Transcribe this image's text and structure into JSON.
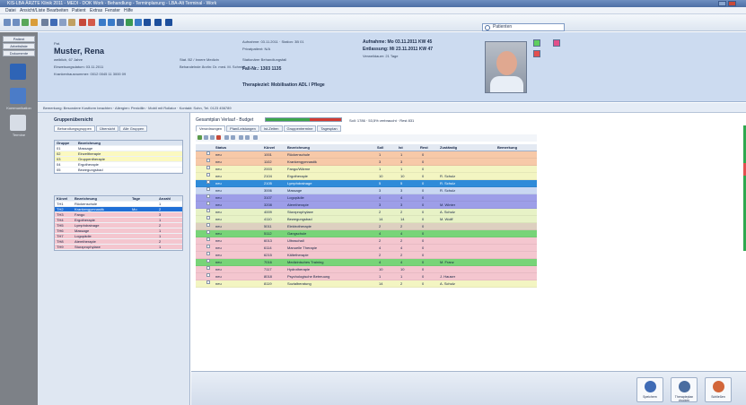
{
  "window": {
    "title": "KIS-LBA ÄRZTE Klinik 2011 - MEDI - DOK Work - Behandlung - Terminplanung - LBA-Alt Terminal - Work"
  },
  "menu": [
    "Datei",
    "Ansicht/Liste",
    "Bearbeiten",
    "Patient",
    "Extras",
    "Fenster",
    "Hilfe"
  ],
  "toolbar": {
    "search_placeholder": "Suchen",
    "search_value": "Patienten"
  },
  "leftbar": [
    {
      "label": "Patient"
    },
    {
      "label": "Arbeitsliste"
    },
    {
      "label": "Dokumente"
    },
    {
      "label": "Kommunikation"
    },
    {
      "label": "Termine"
    }
  ],
  "header": {
    "patient_small": "Pat.",
    "patient_name": "Muster, Rena",
    "lines": [
      "weiblich, 67 Jahre",
      "Einweisungsdatum: 03.11.2011",
      "Krankenhausnummer: 0012 0045 11 3000 09"
    ],
    "ward_lines": [
      "Stat. B2 / Innere Medizin",
      "Behandelnde Ärztin: Dr. med. M. Schmidt"
    ],
    "case_lines": [
      "Aufnahme: 03.11.2011 · Station: 3B 01",
      "Privatpatient: N/A",
      "Stationärer Behandlungsfall"
    ],
    "fall_label": "Fall-Nr.: 1303 1135",
    "diagnosis": "Therapieziel: Mobilisation ADL / Pflege",
    "dates": [
      "Aufnahme: Mo 03.11.2011 KW 45",
      "Entlassung: Mi 23.11.2011 KW 47",
      "Verweildauer: 21 Tage"
    ]
  },
  "infobar": "Bemerkung: Besondere Kostform beachten · Allergien: Penicillin · Mobil mit Rollator · Kontakt: Sohn, Tel. 0123 456789",
  "leftpane": {
    "title": "Gruppenübersicht",
    "tabs": [
      "Behandlungsgruppen",
      "Übersicht",
      "Alle Gruppen"
    ],
    "grid1_headers": [
      "Gruppe",
      "Bezeichnung"
    ],
    "grid1_rows": [
      {
        "code": "01",
        "name": "Massage",
        "bg": "#ffffff"
      },
      {
        "code": "02",
        "name": "Einzeltherapie",
        "bg": "#fbf9c0"
      },
      {
        "code": "03",
        "name": "Gruppentherapie",
        "bg": "#fbf9c0"
      },
      {
        "code": "04",
        "name": "Ergotherapie",
        "bg": "#ffffff"
      },
      {
        "code": "05",
        "name": "Bewegungsbad",
        "bg": "#ffffff"
      }
    ],
    "grid2_headers": [
      "Kürzel",
      "Bezeichnung",
      "Tage",
      "Anzahl"
    ],
    "grid2_rows": [
      {
        "code": "TH1",
        "name": "Rückenschule",
        "f": "",
        "n": "1",
        "bg": "#ffffff"
      },
      {
        "code": "TH2",
        "name": "Krankengymnastik",
        "f": "Mo",
        "n": "2",
        "bg": "#1f6fd6"
      },
      {
        "code": "TH3",
        "name": "Fango",
        "f": "",
        "n": "3",
        "bg": "#f4c6cf"
      },
      {
        "code": "TH4",
        "name": "Ergotherapie",
        "f": "",
        "n": "1",
        "bg": "#f4c6cf"
      },
      {
        "code": "TH5",
        "name": "Lymphdrainage",
        "f": "",
        "n": "2",
        "bg": "#f4c6cf"
      },
      {
        "code": "TH6",
        "name": "Massage",
        "f": "",
        "n": "1",
        "bg": "#f4c6cf"
      },
      {
        "code": "TH7",
        "name": "Logopädie",
        "f": "",
        "n": "1",
        "bg": "#f4c6cf"
      },
      {
        "code": "TH8",
        "name": "Atemtherapie",
        "f": "",
        "n": "2",
        "bg": "#f4c6cf"
      },
      {
        "code": "TH9",
        "name": "Sturzprophylaxe",
        "f": "",
        "n": "1",
        "bg": "#f4c6cf"
      }
    ]
  },
  "main": {
    "title": "Gesamtplan Verlauf - Budget",
    "progress": {
      "green": 0.58,
      "red": 0.42,
      "label": "Soll: 1786 · 53,5% verbraucht · Rest 831"
    },
    "tabs": [
      "Verordnungen",
      "Plan/Leistungen",
      "Ist-Zeiten",
      "Gruppentermine",
      "Tagesplan"
    ],
    "columns": [
      "Status",
      "Kürzel",
      "Bezeichnung",
      "Soll",
      "Ist",
      "Rest",
      "Zuständig",
      "Bemerkung"
    ],
    "rows": [
      {
        "status": "neu",
        "code": "1001",
        "name": "Rückenschule",
        "a": "1",
        "b": "1",
        "c": "0",
        "who": "",
        "bg": "#f7c9a8"
      },
      {
        "status": "neu",
        "code": "1102",
        "name": "Krankengymnastik",
        "a": "3",
        "b": "3",
        "c": "0",
        "who": "",
        "bg": "#f7c9a8"
      },
      {
        "status": "neu",
        "code": "2003",
        "name": "Fango/Wärme",
        "a": "1",
        "b": "1",
        "c": "0",
        "who": "",
        "bg": "#f3f5c2"
      },
      {
        "status": "neu",
        "code": "2104",
        "name": "Ergotherapie",
        "a": "10",
        "b": "10",
        "c": "0",
        "who": "R. Schulz",
        "bg": "#f3f5c2"
      },
      {
        "status": "neu",
        "code": "2105",
        "name": "Lymphdrainage",
        "a": "5",
        "b": "5",
        "c": "0",
        "who": "R. Schulz",
        "bg": "#2f8bd9"
      },
      {
        "status": "neu",
        "code": "3006",
        "name": "Massage",
        "a": "3",
        "b": "3",
        "c": "0",
        "who": "R. Schulz",
        "bg": "#c9d7f2"
      },
      {
        "status": "neu",
        "code": "3107",
        "name": "Logopädie",
        "a": "4",
        "b": "4",
        "c": "0",
        "who": "",
        "bg": "#9d9ee8"
      },
      {
        "status": "neu",
        "code": "3208",
        "name": "Atemtherapie",
        "a": "3",
        "b": "3",
        "c": "0",
        "who": "M. Winter",
        "bg": "#9d9ee8"
      },
      {
        "status": "neu",
        "code": "4009",
        "name": "Sturzprophylaxe",
        "a": "2",
        "b": "2",
        "c": "0",
        "who": "A. Schulz",
        "bg": "#e7f2c6"
      },
      {
        "status": "neu",
        "code": "4110",
        "name": "Bewegungsbad",
        "a": "14",
        "b": "14",
        "c": "0",
        "who": "M. Wolff",
        "bg": "#e7f2c6"
      },
      {
        "status": "neu",
        "code": "5011",
        "name": "Elektrotherapie",
        "a": "2",
        "b": "2",
        "c": "0",
        "who": "",
        "bg": "#ddd0c0"
      },
      {
        "status": "neu",
        "code": "5112",
        "name": "Gangschule",
        "a": "4",
        "b": "4",
        "c": "0",
        "who": "",
        "bg": "#78d478"
      },
      {
        "status": "neu",
        "code": "6013",
        "name": "Ultraschall",
        "a": "2",
        "b": "2",
        "c": "0",
        "who": "",
        "bg": "#f4c6cf"
      },
      {
        "status": "neu",
        "code": "6114",
        "name": "Manuelle Therapie",
        "a": "4",
        "b": "4",
        "c": "0",
        "who": "",
        "bg": "#f4c6cf"
      },
      {
        "status": "neu",
        "code": "6215",
        "name": "Kältetherapie",
        "a": "2",
        "b": "2",
        "c": "0",
        "who": "",
        "bg": "#f4c6cf"
      },
      {
        "status": "neu",
        "code": "7016",
        "name": "Medizinisches Training",
        "a": "4",
        "b": "4",
        "c": "0",
        "who": "M. Franz",
        "bg": "#78d478"
      },
      {
        "status": "neu",
        "code": "7117",
        "name": "Hydrotherapie",
        "a": "10",
        "b": "10",
        "c": "0",
        "who": "",
        "bg": "#f4c6cf"
      },
      {
        "status": "neu",
        "code": "8018",
        "name": "Psychologische Betreuung",
        "a": "1",
        "b": "1",
        "c": "0",
        "who": "J. Hauser",
        "bg": "#f4c6cf"
      },
      {
        "status": "neu",
        "code": "8119",
        "name": "Sozialberatung",
        "a": "14",
        "b": "2",
        "c": "0",
        "who": "A. Schulz",
        "bg": "#f3f5c2"
      }
    ]
  },
  "buttons": [
    "Speichern",
    "Therapieplan drucken",
    "Schließen"
  ],
  "colors": {
    "accent": "#1f6fd6",
    "header_bg": "#ccdbf0",
    "leftbar_bg": "#7d8187"
  }
}
